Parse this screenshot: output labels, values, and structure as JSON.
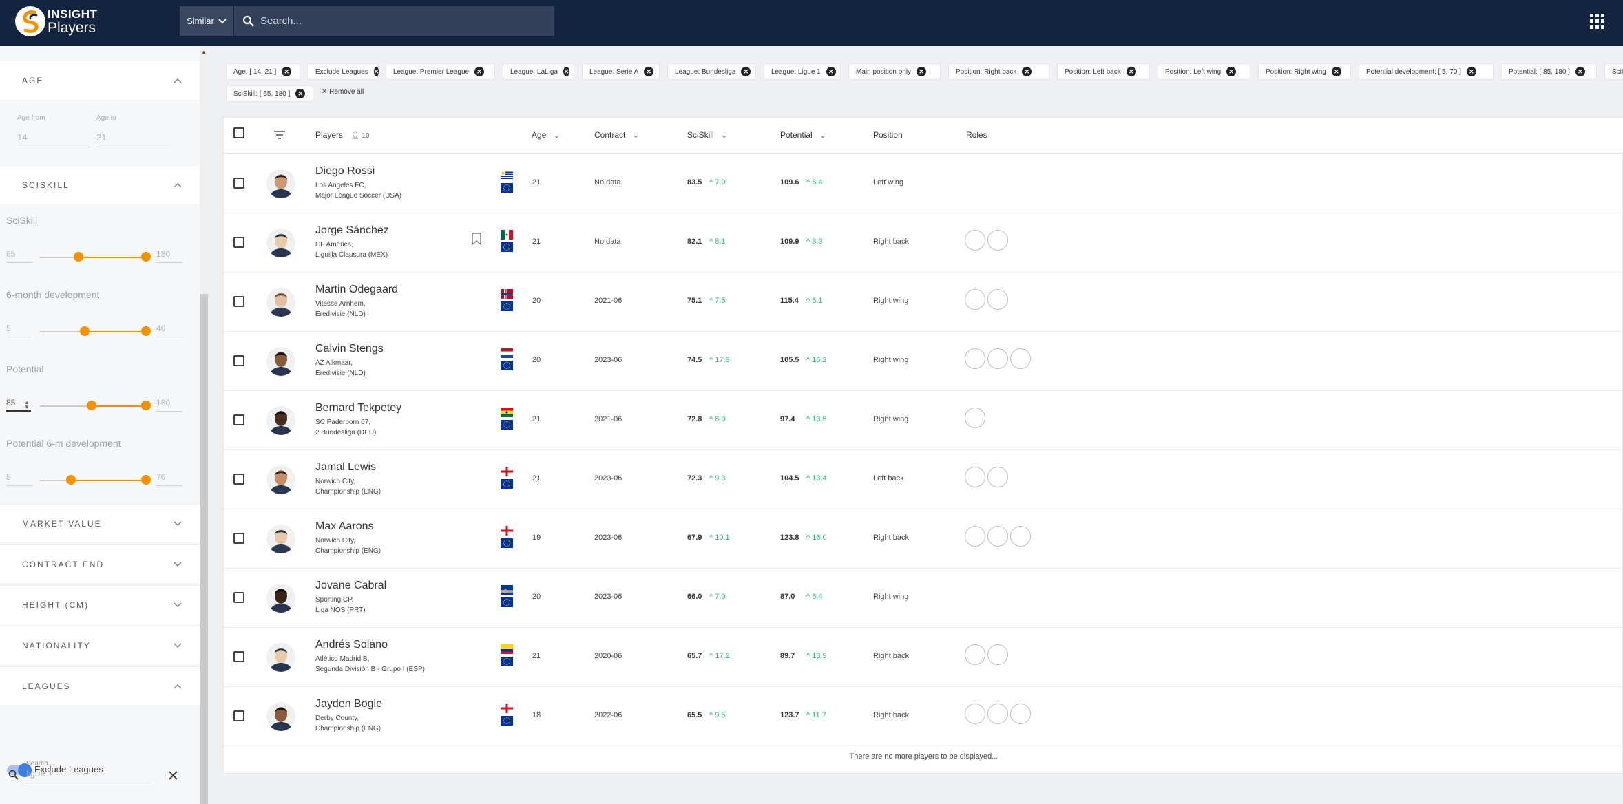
{
  "app": {
    "brand_top": "INSIGHT",
    "brand_bottom": "Players"
  },
  "header": {
    "similar_label": "Similar",
    "search_placeholder": "Search..."
  },
  "sidebar": {
    "age": {
      "title": "AGE",
      "from_label": "Age from",
      "to_label": "Age to",
      "from_value": "14",
      "to_value": "21"
    },
    "sciskill": {
      "title": "SCISKILL",
      "sliders": [
        {
          "label": "SciSkill",
          "min": "65",
          "max": "180",
          "value_min": 65,
          "value_max": 180
        },
        {
          "label": "6-month development",
          "min": "5",
          "max": "40",
          "value_min": 5,
          "value_max": 40
        },
        {
          "label": "Potential",
          "min": "85",
          "max": "180",
          "value_min": 85,
          "value_max": 180
        },
        {
          "label": "Potential 6-m development",
          "min": "5",
          "max": "70",
          "value_min": 5,
          "value_max": 70
        }
      ]
    },
    "collapsed_sections": [
      "MARKET VALUE",
      "CONTRACT END",
      "HEIGHT (CM)",
      "NATIONALITY"
    ],
    "leagues": {
      "title": "LEAGUES",
      "exclude_label": "Exclude Leagues",
      "exclude_on": true,
      "search_label": "Search...",
      "search_value": "ligue 1"
    }
  },
  "filters": {
    "chips": [
      "Age: [ 14, 21 ]",
      "Exclude Leagues",
      "League: Premier League",
      "League: LaLiga",
      "League: Serie A",
      "League: Bundesliga",
      "League: Ligue 1",
      "Main position only",
      "Position: Right back",
      "Position: Left back",
      "Position: Left wing",
      "Position: Right wing",
      "Potential development: [ 5, 70 ]",
      "Potential: [ 85, 180 ]",
      "SciSki"
    ],
    "chips_row2": [
      "SciSkill: [ 65, 180 ]"
    ],
    "remove_all": "Remove all"
  },
  "table": {
    "columns": {
      "players": "Players",
      "player_count": "10",
      "age": "Age",
      "contract": "Contract",
      "sciskill": "SciSkill",
      "potential": "Potential",
      "position": "Position",
      "roles": "Roles"
    },
    "rows": [
      {
        "name": "Diego Rossi",
        "team": "Los Angeles FC,",
        "league": "Major League Soccer (USA)",
        "flag": "URY",
        "age": "21",
        "contract": "No data",
        "sciskill": "83.5",
        "sciskill_delta": "7.9",
        "potential": "109.6",
        "potential_delta": "6.4",
        "position": "Left wing",
        "roles": 0,
        "bookmark": false,
        "skin": "#c99a74",
        "hair": "#2a1a10"
      },
      {
        "name": "Jorge Sánchez",
        "team": "CF América,",
        "league": "Liguilla Clausura (MEX)",
        "flag": "MEX",
        "age": "21",
        "contract": "No data",
        "sciskill": "82.1",
        "sciskill_delta": "8.1",
        "potential": "109.9",
        "potential_delta": "8.3",
        "position": "Right back",
        "roles": 2,
        "bookmark": true,
        "skin": "#e8c9a8",
        "hair": "#1c2a44"
      },
      {
        "name": "Martin Odegaard",
        "team": "Vitesse Arnhem,",
        "league": "Eredivisie (NLD)",
        "flag": "NOR",
        "age": "20",
        "contract": "2021-06",
        "sciskill": "75.1",
        "sciskill_delta": "7.5",
        "potential": "115.4",
        "potential_delta": "5.1",
        "position": "Right wing",
        "roles": 2,
        "bookmark": false,
        "skin": "#e2bfa2",
        "hair": "#6b4a30"
      },
      {
        "name": "Calvin Stengs",
        "team": "AZ Alkmaar,",
        "league": "Eredivisie (NLD)",
        "flag": "NLD",
        "age": "20",
        "contract": "2023-06",
        "sciskill": "74.5",
        "sciskill_delta": "17.9",
        "potential": "105.5",
        "potential_delta": "16.2",
        "position": "Right wing",
        "roles": 3,
        "bookmark": false,
        "skin": "#8a5a3a",
        "hair": "#1a0e08"
      },
      {
        "name": "Bernard Tekpetey",
        "team": "SC Paderborn 07,",
        "league": "2.Bundesliga (DEU)",
        "flag": "GHA",
        "age": "21",
        "contract": "2021-06",
        "sciskill": "72.8",
        "sciskill_delta": "8.0",
        "potential": "97.4",
        "potential_delta": "13.5",
        "position": "Right wing",
        "roles": 1,
        "bookmark": false,
        "skin": "#4a2c20",
        "hair": "#120a06"
      },
      {
        "name": "Jamal Lewis",
        "team": "Norwich City,",
        "league": "Championship (ENG)",
        "flag": "ENG",
        "age": "21",
        "contract": "2023-06",
        "sciskill": "72.3",
        "sciskill_delta": "9.3",
        "potential": "104.5",
        "potential_delta": "13.4",
        "position": "Left back",
        "roles": 2,
        "bookmark": false,
        "skin": "#c48e68",
        "hair": "#2a1a10"
      },
      {
        "name": "Max Aarons",
        "team": "Norwich City,",
        "league": "Championship (ENG)",
        "flag": "ENG",
        "age": "19",
        "contract": "2023-06",
        "sciskill": "67.9",
        "sciskill_delta": "10.1",
        "potential": "123.8",
        "potential_delta": "16.0",
        "position": "Right back",
        "roles": 3,
        "bookmark": false,
        "skin": "#e8c9a8",
        "hair": "#1c2a44"
      },
      {
        "name": "Jovane Cabral",
        "team": "Sporting CP,",
        "league": "Liga NOS (PRT)",
        "flag": "CPV",
        "age": "20",
        "contract": "2023-06",
        "sciskill": "66.0",
        "sciskill_delta": "7.0",
        "potential": "87.0",
        "potential_delta": "6.4",
        "position": "Right wing",
        "roles": 0,
        "bookmark": false,
        "skin": "#3a2418",
        "hair": "#0e0804"
      },
      {
        "name": "Andrés Solano",
        "team": "Atlético Madrid B,",
        "league": "Segunda División B - Grupo I (ESP)",
        "flag": "COL",
        "age": "21",
        "contract": "2020-06",
        "sciskill": "65.7",
        "sciskill_delta": "17.2",
        "potential": "89.7",
        "potential_delta": "13.9",
        "position": "Right back",
        "roles": 2,
        "bookmark": false,
        "skin": "#e8c9a8",
        "hair": "#1c2a44"
      },
      {
        "name": "Jayden Bogle",
        "team": "Derby County,",
        "league": "Championship (ENG)",
        "flag": "ENG",
        "age": "18",
        "contract": "2022-06",
        "sciskill": "65.5",
        "sciskill_delta": "9.5",
        "potential": "123.7",
        "potential_delta": "11.7",
        "position": "Right back",
        "roles": 3,
        "bookmark": false,
        "skin": "#8a5a3a",
        "hair": "#1a0e08"
      }
    ],
    "footer": "There are no more players to be displayed..."
  },
  "colors": {
    "navy": "#132440",
    "orange": "#f39200",
    "green": "#2bb673",
    "toggle_blue": "#3d7fe0"
  }
}
